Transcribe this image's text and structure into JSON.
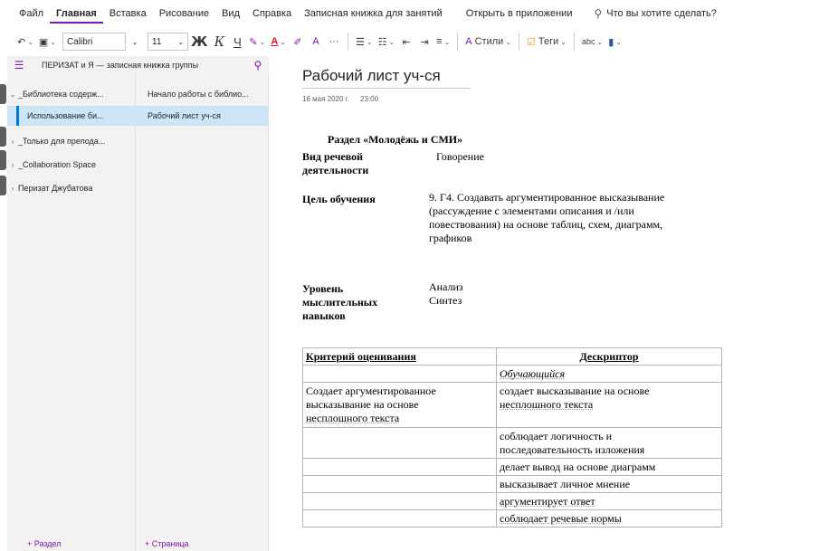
{
  "menu": {
    "items": [
      "Файл",
      "Главная",
      "Вставка",
      "Рисование",
      "Вид",
      "Справка",
      "Записная книжка для занятий",
      "Открыть в приложении"
    ],
    "tell_me": "Что вы хотите сделать?"
  },
  "toolbar": {
    "font": "Calibri",
    "size": "11",
    "bold": "Ж",
    "italic": "К",
    "underline": "Ч",
    "styles_label": "Стили",
    "tags_label": "Теги",
    "more": "···"
  },
  "notebook": {
    "title": "ПЕРИЗАТ и Я — записная книжка группы",
    "sections": [
      {
        "label": "_Библиотека содерж...",
        "chevron": "⌄"
      },
      {
        "label": "Использование би...",
        "chevron": ""
      },
      {
        "label": "_Только для препода...",
        "chevron": "›"
      },
      {
        "label": "_Collaboration Space",
        "chevron": "›"
      },
      {
        "label": "Перизат Джубатова",
        "chevron": "›"
      }
    ],
    "pages": [
      "Начало работы с библио...",
      "Рабочий лист уч-ся"
    ],
    "add_section": "+ Раздел",
    "add_page": "+ Страница"
  },
  "page": {
    "title": "Рабочий лист уч-ся",
    "date": "16 мая 2020 г.",
    "time": "23:00",
    "section_heading": "Раздел  «Молодёжь и СМИ»",
    "activity_label_1": "Вид речевой",
    "activity_label_2": "деятельности",
    "activity_value": "Говорение",
    "goal_label": "Цель обучения",
    "goal_lines": [
      "9. Г4. Создавать аргументированное высказывание",
      "(рассуждение с элементами описания и /или",
      "повествования) на основе таблиц, схем, диаграмм,",
      "графиков"
    ],
    "level_label_lines": [
      "Уровень",
      "мыслительных",
      "навыков"
    ],
    "level_values": [
      "Анализ",
      "Синтез"
    ],
    "table": {
      "headers": [
        "Критерий оценивания",
        "Дескриптор"
      ],
      "learner": "Обучающийся",
      "criterion_lines": [
        "Создает аргументированное",
        "высказывание на основе",
        "несплошного текста"
      ],
      "descriptors": [
        [
          "создает высказывание на основе",
          "несплошного текста"
        ],
        [
          "соблюдает логичность и",
          "последовательность изложения"
        ],
        [
          "делает вывод на основе диаграмм"
        ],
        [
          "высказывает личное мнение"
        ],
        [
          "аргументирует ответ"
        ],
        [
          "соблюдает речевые нормы"
        ]
      ]
    }
  }
}
